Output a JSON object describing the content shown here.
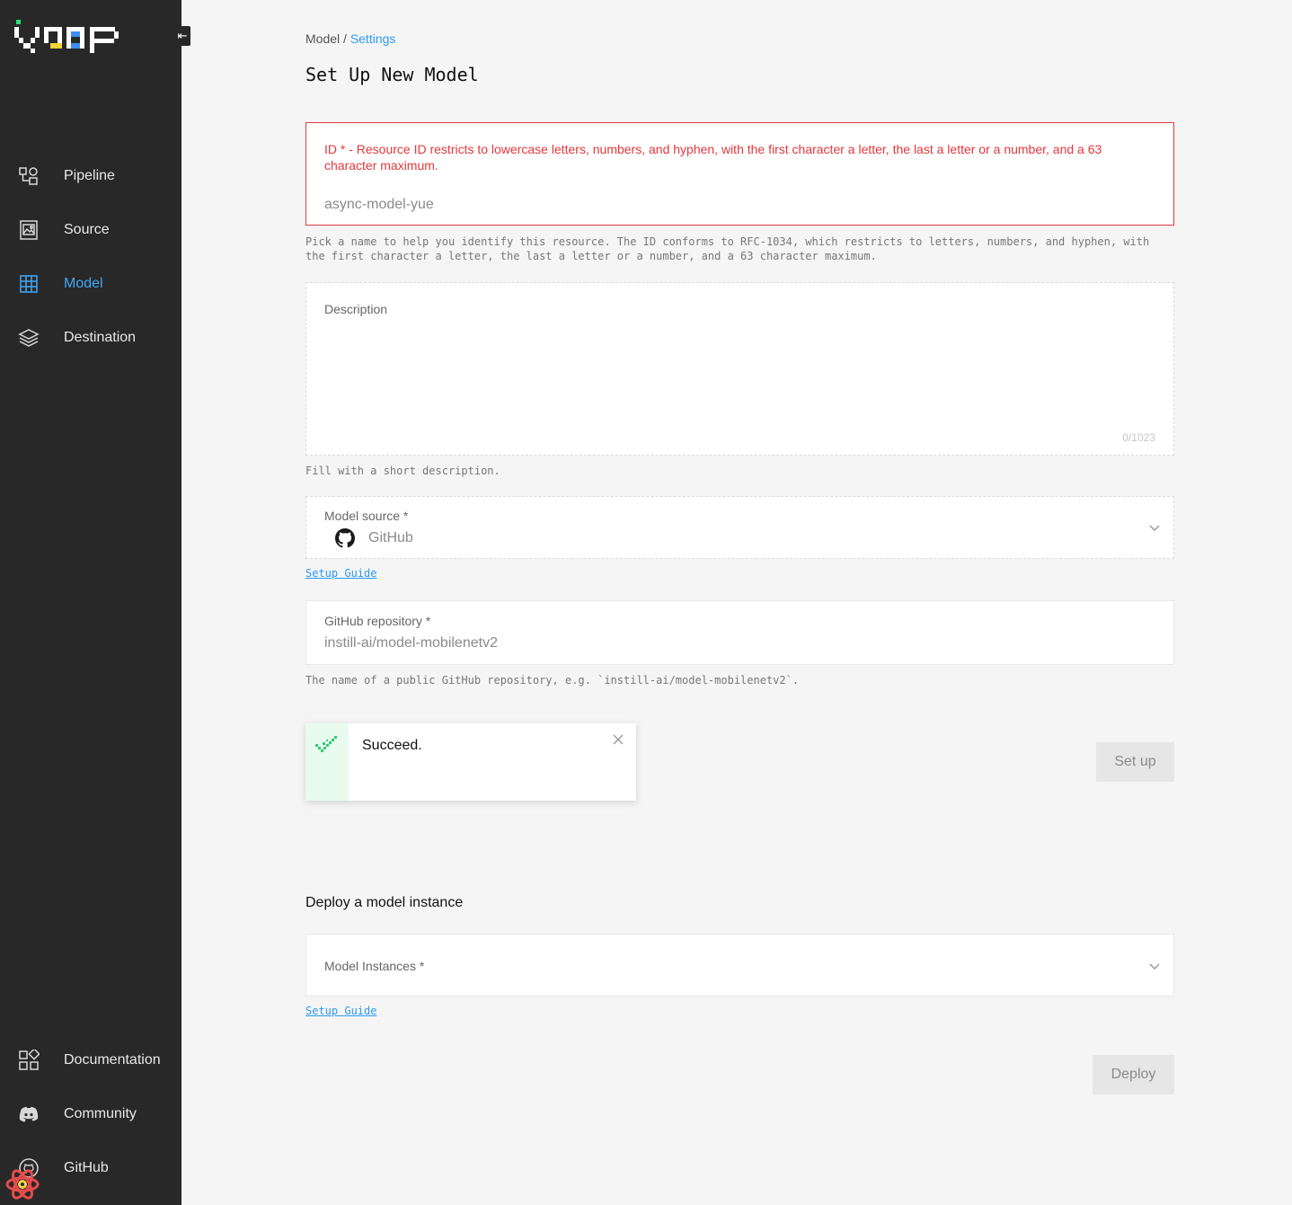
{
  "sidebar": {
    "collapse_glyph": "⇤",
    "items": [
      {
        "label": "Pipeline",
        "icon": "pipeline-icon"
      },
      {
        "label": "Source",
        "icon": "image-icon"
      },
      {
        "label": "Model",
        "icon": "grid-icon",
        "active": true
      },
      {
        "label": "Destination",
        "icon": "layers-icon"
      }
    ],
    "bottom_items": [
      {
        "label": "Documentation",
        "icon": "blocks-icon"
      },
      {
        "label": "Community",
        "icon": "discord-icon"
      },
      {
        "label": "GitHub",
        "icon": "github-icon"
      }
    ]
  },
  "breadcrumb": {
    "parent": "Model",
    "separator": " / ",
    "current": "Settings"
  },
  "page_title": "Set Up New Model",
  "id_field": {
    "error_label": "ID * - Resource ID restricts to lowercase letters, numbers, and hyphen, with the first character a letter, the last a letter or a number, and a 63 character maximum.",
    "value": "async-model-yue",
    "help": "Pick a name to help you identify this resource. The ID conforms to RFC-1034, which restricts to letters, numbers, and hyphen, with the first character a letter, the last a letter or a number, and a 63 character maximum."
  },
  "description_field": {
    "label": "Description",
    "counter": "0/1023",
    "help": "Fill with a short description."
  },
  "model_source": {
    "label": "Model source *",
    "value": "GitHub",
    "link": "Setup Guide"
  },
  "github_repo": {
    "label": "GitHub repository *",
    "value": "instill-ai/model-mobilenetv2",
    "help": "The name of a public GitHub repository, e.g. `instill-ai/model-mobilenetv2`."
  },
  "toast": {
    "message": "Succeed."
  },
  "setup_button": "Set up",
  "deploy_section": {
    "title": "Deploy a model instance",
    "instances_label": "Model Instances *",
    "link": "Setup Guide",
    "deploy_button": "Deploy"
  },
  "colors": {
    "accent": "#2b9af3",
    "error": "#e4373b",
    "sidebar_bg": "#282828",
    "success": "#2ecc71"
  }
}
